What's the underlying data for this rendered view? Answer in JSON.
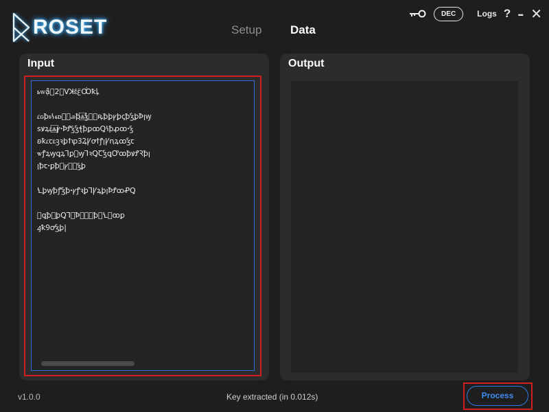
{
  "app": {
    "brand": "ROSET",
    "logo_icon": "roset-logo-icon",
    "version": "v1.0.0"
  },
  "nav": {
    "tabs": [
      {
        "label": "Setup",
        "active": false
      },
      {
        "label": "Data",
        "active": true
      }
    ]
  },
  "top_bar": {
    "key_icon": "key-icon",
    "mode_toggle": "DEC",
    "logs_label": "Logs",
    "help_label": "?",
    "minimize_label": "–",
    "close_label": "✕"
  },
  "input_panel": {
    "title": "Input",
    "text": "ꮟꮃậ̉⃞2⃞Ⅴꓘꮛ̊ꜫ̈Ꝏ̒ꝁꝲ\n\nꮭꮐꝥꭶꝇꮞꭰꝸ⃞ꮚꝥꮬ⃞ꝣꝍ⃞ꝶꝥꝧꝩꝧꞔꝥꝢꝧꝤꞁꝡ\nꜱꝟꝝꮭꮬ⃞ꝩꞏꝤꝬꝣꝢꞎꝥꝑꝏꝖꝇꝥꝓꝏꞏꝣ\nꞝꝁꮭꞇꮛꝫꝛꝧꝉꝕꝪꝜꝨꝍꝉꝭꞁꝨꞑꝝꝏꝢꞇ\nꮤꝭꝝꝡꝗꝝꞀꝑ⃞ꝡꞀꝛꝖꞆꝢꝗꝌꝏꝥꝟꝬꝚꝥꞁ\nꞁꝥꞇꞏꝑꝥ⃞ꝩꝢ⃞ꝣꝧ\n\nꝆꝧꝡꝥꝭꝢꝥꞏꝩꝭꝛꝧꞀꝨꝝꝧꞁꝤꝬꝏꝒꝖ\n\n⃞ꝗꝥ⃞ꝧꝖꞀꝩꝤꝟꝪꝡꝥꝣꝆꝩꝏꝑ\nꜭꝁꝮꝍꝢꝧ|"
  },
  "output_panel": {
    "title": "Output",
    "text": ""
  },
  "status_bar": {
    "status": "Key extracted (in 0.012s)",
    "process_label": "Process"
  },
  "colors": {
    "background": "#1e1e1e",
    "panel": "#2c2c2c",
    "text_area": "#232323",
    "accent_blue": "#2f78e0",
    "highlight_red": "#d02020"
  }
}
